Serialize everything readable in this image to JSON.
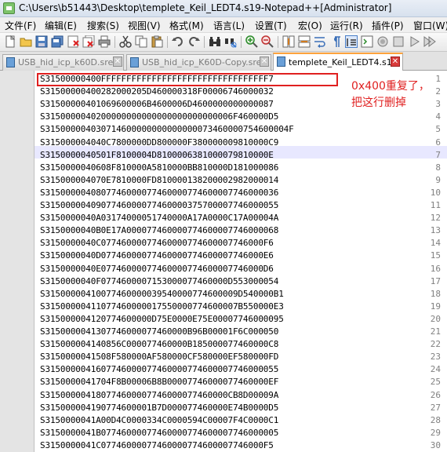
{
  "window": {
    "title": "C:\\Users\\b51443\\Desktop\\templete_Keil_LEDT4.s19 - Notepad++ [Administrator]"
  },
  "menu": [
    "文件(F)",
    "编辑(E)",
    "搜索(S)",
    "视图(V)",
    "格式(M)",
    "语言(L)",
    "设置(T)",
    "宏(O)",
    "运行(R)",
    "插件(P)",
    "窗口(W)"
  ],
  "toolbar": {
    "icons": [
      "new-file-icon",
      "open-file-icon",
      "save-icon",
      "save-all-icon",
      "close-icon",
      "close-all-icon",
      "print-icon",
      "cut-icon",
      "copy-icon",
      "paste-icon",
      "undo-icon",
      "redo-icon",
      "find-icon",
      "replace-icon",
      "zoom-in-icon",
      "zoom-out-icon",
      "sync-vertical-icon",
      "sync-horizontal-icon",
      "word-wrap-icon",
      "show-all-chars-icon",
      "indent-guide-icon",
      "user-defined-language-icon"
    ]
  },
  "tabs": [
    {
      "label": "USB_hid_icp_k60D.srec",
      "active": false
    },
    {
      "label": "USB_hid_icp_K60D - Copy.srec",
      "active": false
    },
    {
      "label": "templete_Keil_LEDT4.s19",
      "active": true
    }
  ],
  "editor": {
    "current_line": 7,
    "lines": [
      {
        "num": "1",
        "text": "S31500000400FFFFFFFFFFFFFFFFFFFFFFFFFFFFFFFFF7"
      },
      {
        "num": "2",
        "text": "S315000004002820002 05D460000318F00006746000032"
      },
      {
        "num": "3",
        "text": "S3150000040106960000 6B4600006D4600000000000087"
      },
      {
        "num": "4",
        "text": "S3150000040200000000000000000000000006F460000D5"
      },
      {
        "num": "5",
        "text": "S315000004030714600000000000000073460000754600004F"
      },
      {
        "num": "6",
        "text": "S3150000040 4 0C7800000DD800000F380000009810000C9"
      },
      {
        "num": "7",
        "text": "S31500000405 01F810000 4D8100006381000079810000E"
      },
      {
        "num": "8",
        "text": "S31500000406 08F810000A5810000BB810000D181000086"
      },
      {
        "num": "9",
        "text": "S315000004070E7810000FD81000013820000298200 0014"
      },
      {
        "num": "10",
        "text": "S31500000408077460000774600007746000077460000 36"
      },
      {
        "num": "11",
        "text": "S315000004090774600007746000037570000 7746000055"
      },
      {
        "num": "12",
        "text": "S31500000 40A0317400005174000 0A17A0000C17A00004A"
      },
      {
        "num": "13",
        "text": "S31500000 40B0E17A000077460000774600007746000068"
      },
      {
        "num": "14",
        "text": "S31500000 40C0774600007746000077460000774600 0F6"
      },
      {
        "num": "15",
        "text": "S31500000 40D0774600007746000077460000774600 0E6"
      },
      {
        "num": "16",
        "text": "S31500000 40E0774600007746000077460000774600 0D6"
      },
      {
        "num": "17",
        "text": "S31500000 40F0774600007153000077460000D553000054"
      },
      {
        "num": "18",
        "text": "S31500000 41007746000003954000077460000 9D540000B1"
      },
      {
        "num": "19",
        "text": "S31500000 41107746000001755000077460000 7B550000E3"
      },
      {
        "num": "20",
        "text": "S31500000 4120774600000D75E0000E75E00007746000095"
      },
      {
        "num": "21",
        "text": "S31500000 4130774600007746000 0B96B00001F6C000050"
      },
      {
        "num": "22",
        "text": "S31500000 41408 56C000077460000B185000077460000C8"
      },
      {
        "num": "23",
        "text": "S31500000 41508F580000AF580000CF580000EF580000FD"
      },
      {
        "num": "24",
        "text": "S31500000 4160774600007746000077460000774600 0055"
      },
      {
        "num": "25",
        "text": "S31500000 41704F8B00006B8B000077460000774600 00EF"
      },
      {
        "num": "26",
        "text": "S31500000 4180774600007746000077460000CB8D00009A"
      },
      {
        "num": "27",
        "text": "S31500000 4190774600001B7D00007746000 0E74B0000D5"
      },
      {
        "num": "28",
        "text": "S31500000 41A00D4C0000334C0000594C00007F4C0000C1"
      },
      {
        "num": "29",
        "text": "S31500000 41B07746000077460000774600007746000005"
      },
      {
        "num": "30",
        "text": "S31500000 41C07746000077460000774600007746000 F5"
      }
    ]
  },
  "annotation": {
    "line1": "0x400 重复了，",
    "line2": "把这行删掉",
    "color": "#e02020"
  }
}
